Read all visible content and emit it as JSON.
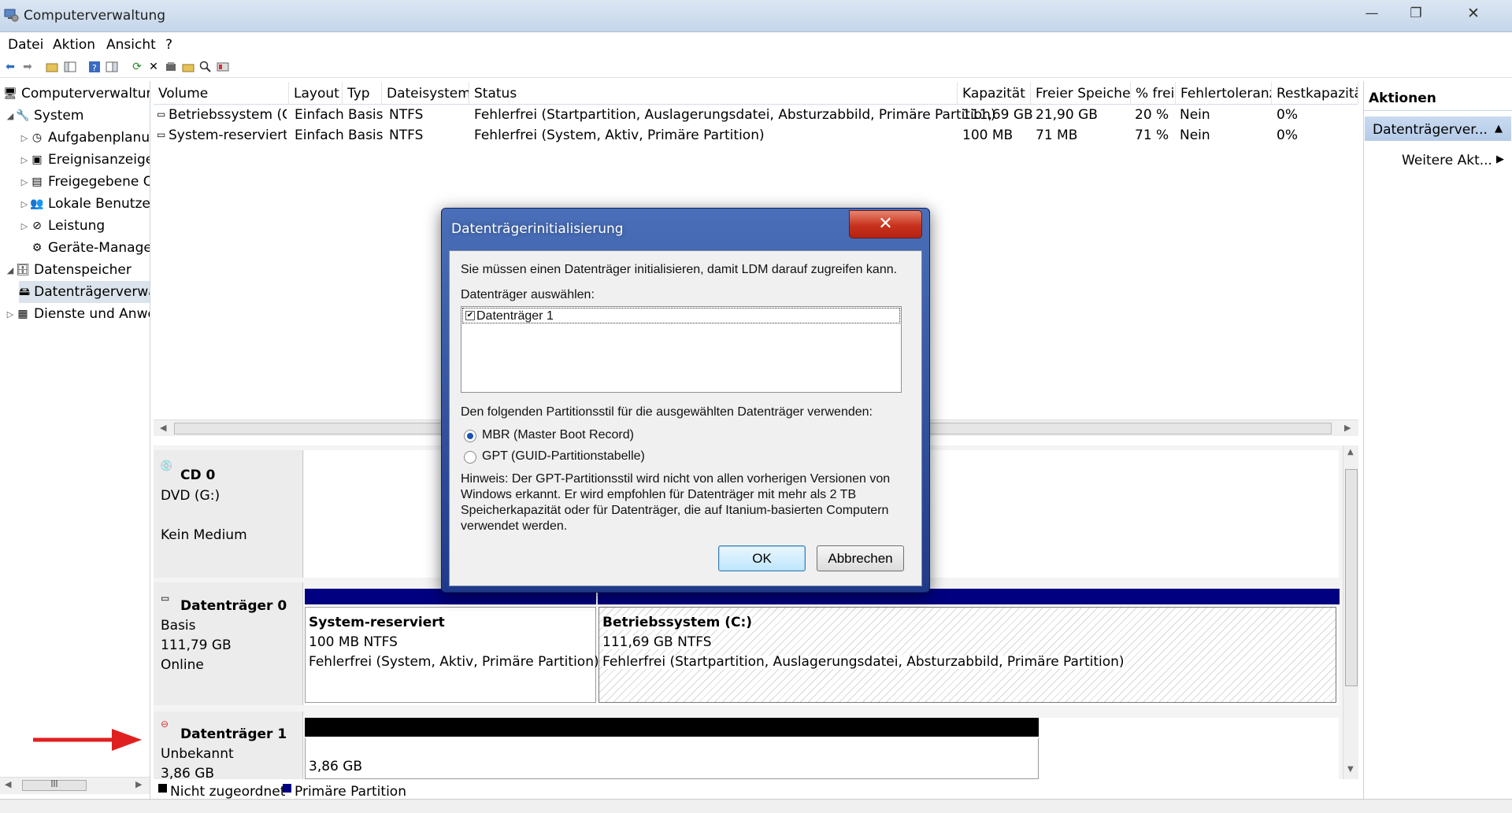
{
  "window": {
    "title": "Computerverwaltung",
    "minimize_glyph": "—",
    "restore_glyph": "❐",
    "close_glyph": "✕"
  },
  "menu": [
    "Datei",
    "Aktion",
    "Ansicht",
    "?"
  ],
  "tree": [
    {
      "label": "Computerverwaltung (Lokal)",
      "level": 0,
      "icon": "computer-icon"
    },
    {
      "label": "System",
      "level": 1,
      "icon": "tools-icon",
      "expander": "◢"
    },
    {
      "label": "Aufgabenplanung",
      "level": 2,
      "icon": "clock-icon",
      "expander": "▷"
    },
    {
      "label": "Ereignisanzeige",
      "level": 2,
      "icon": "event-icon",
      "expander": "▷"
    },
    {
      "label": "Freigegebene Ordner",
      "level": 2,
      "icon": "share-icon",
      "expander": "▷"
    },
    {
      "label": "Lokale Benutzer und Gruppen",
      "level": 2,
      "icon": "users-icon",
      "expander": "▷"
    },
    {
      "label": "Leistung",
      "level": 2,
      "icon": "performance-icon",
      "expander": "▷"
    },
    {
      "label": "Geräte-Manager",
      "level": 2,
      "icon": "device-icon"
    },
    {
      "label": "Datenspeicher",
      "level": 1,
      "icon": "storage-icon",
      "expander": "◢"
    },
    {
      "label": "Datenträgerverwaltung",
      "level": 2,
      "icon": "disk-icon",
      "selected": true
    },
    {
      "label": "Dienste und Anwendungen",
      "level": 1,
      "icon": "services-icon",
      "expander": "▷"
    }
  ],
  "columns": [
    "Volume",
    "Layout",
    "Typ",
    "Dateisystem",
    "Status",
    "Kapazität",
    "Freier Speicher",
    "% frei",
    "Fehlertoleranz",
    "Restkapazität"
  ],
  "volumes": [
    [
      "Betriebssystem (C:)",
      "Einfach",
      "Basis",
      "NTFS",
      "Fehlerfrei (Startpartition, Auslagerungsdatei, Absturzabbild, Primäre Partition)",
      "111,69 GB",
      "21,90 GB",
      "20 %",
      "Nein",
      "0%"
    ],
    [
      "System-reserviert",
      "Einfach",
      "Basis",
      "NTFS",
      "Fehlerfrei (System, Aktiv, Primäre Partition)",
      "100 MB",
      "71 MB",
      "71 %",
      "Nein",
      "0%"
    ]
  ],
  "disks": {
    "cd0": {
      "name": "CD 0",
      "line1": "DVD (G:)",
      "line2": "Kein Medium"
    },
    "disk0": {
      "name": "Datenträger 0",
      "type": "Basis",
      "size": "111,79 GB",
      "status": "Online",
      "p1": {
        "name": "System-reserviert",
        "size": "100 MB NTFS",
        "status": "Fehlerfrei (System, Aktiv, Primäre Partition)"
      },
      "p2": {
        "name": "Betriebssystem  (C:)",
        "size": "111,69 GB NTFS",
        "status": "Fehlerfrei (Startpartition, Auslagerungsdatei, Absturzabbild, Primäre Partition)"
      }
    },
    "disk1": {
      "name": "Datenträger 1",
      "type": "Unbekannt",
      "size": "3,86 GB",
      "partition_size": "3,86 GB"
    }
  },
  "legend": [
    {
      "label": "Nicht zugeordnet",
      "color": "#000000"
    },
    {
      "label": "Primäre Partition",
      "color": "#000080"
    }
  ],
  "actions": {
    "header": "Aktionen",
    "section": "Datenträgerver...",
    "more": "Weitere Akt..."
  },
  "dialog": {
    "title": "Datenträgerinitialisierung",
    "intro": "Sie müssen einen Datenträger initialisieren, damit LDM darauf zugreifen kann.",
    "select_label": "Datenträger auswählen:",
    "disk_item": "Datenträger 1",
    "style_label": "Den folgenden Partitionsstil für die ausgewählten Datenträger verwenden:",
    "mbr": "MBR (Master Boot Record)",
    "gpt": "GPT (GUID-Partitionstabelle)",
    "hint_lines": [
      "Hinweis: Der GPT-Partitionsstil wird nicht von allen vorherigen Versionen von",
      "Windows erkannt. Er wird empfohlen für Datenträger mit mehr als 2 TB",
      "Speicherkapazität oder für Datenträger, die auf Itanium-basierten Computern",
      "verwendet werden."
    ],
    "ok": "OK",
    "cancel": "Abbrechen",
    "selected_style": "MBR"
  },
  "colors": {
    "primary_partition": "#000080",
    "unallocated": "#000000",
    "annotation_arrow": "#e02020"
  }
}
